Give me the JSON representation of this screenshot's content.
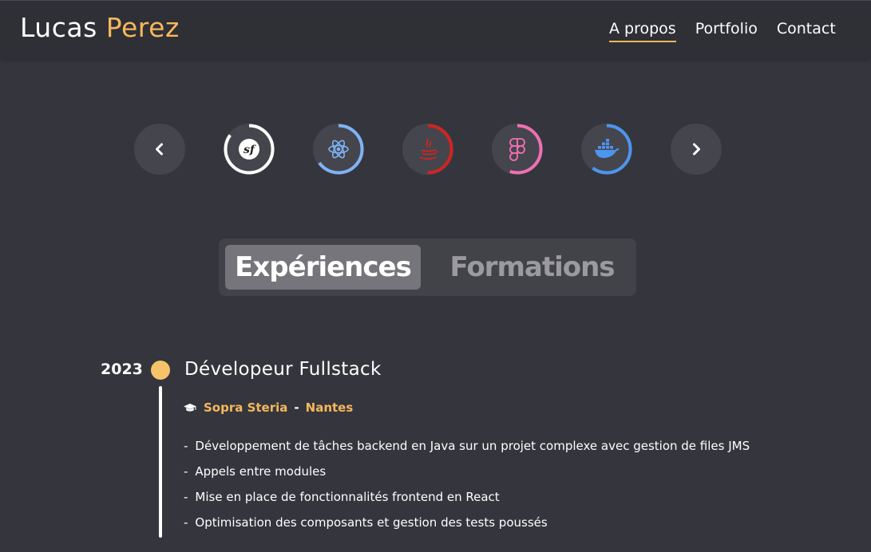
{
  "header": {
    "brand_first": "Lucas",
    "brand_last": "Perez",
    "nav": [
      {
        "label": "A propos",
        "active": true
      },
      {
        "label": "Portfolio",
        "active": false
      },
      {
        "label": "Contact",
        "active": false
      }
    ]
  },
  "skills": [
    {
      "name": "symfony-icon",
      "color": "#ffffff",
      "level": 0.85
    },
    {
      "name": "react-icon",
      "color": "#7fb3f5",
      "level": 0.65
    },
    {
      "name": "java-icon",
      "color": "#d0251f",
      "level": 0.5
    },
    {
      "name": "figma-icon",
      "color": "#f06fb3",
      "level": 0.55
    },
    {
      "name": "docker-icon",
      "color": "#4d95f0",
      "level": 0.6
    }
  ],
  "tabs": {
    "experiences": "Expériences",
    "formations": "Formations"
  },
  "timeline": {
    "year": "2023",
    "title": "Dévelopeur Fullstack",
    "company": "Sopra Steria",
    "separator": "-",
    "city": "Nantes",
    "dash": "-",
    "tasks": [
      "Développement de tâches backend en Java sur un projet complexe avec gestion de files JMS",
      "Appels entre modules",
      "Mise en place de fonctionnalités frontend en React",
      "Optimisation des composants et gestion des tests poussés"
    ]
  },
  "colors": {
    "accent": "#f5b85c",
    "background": "#35353d",
    "header": "#2f2f36"
  }
}
